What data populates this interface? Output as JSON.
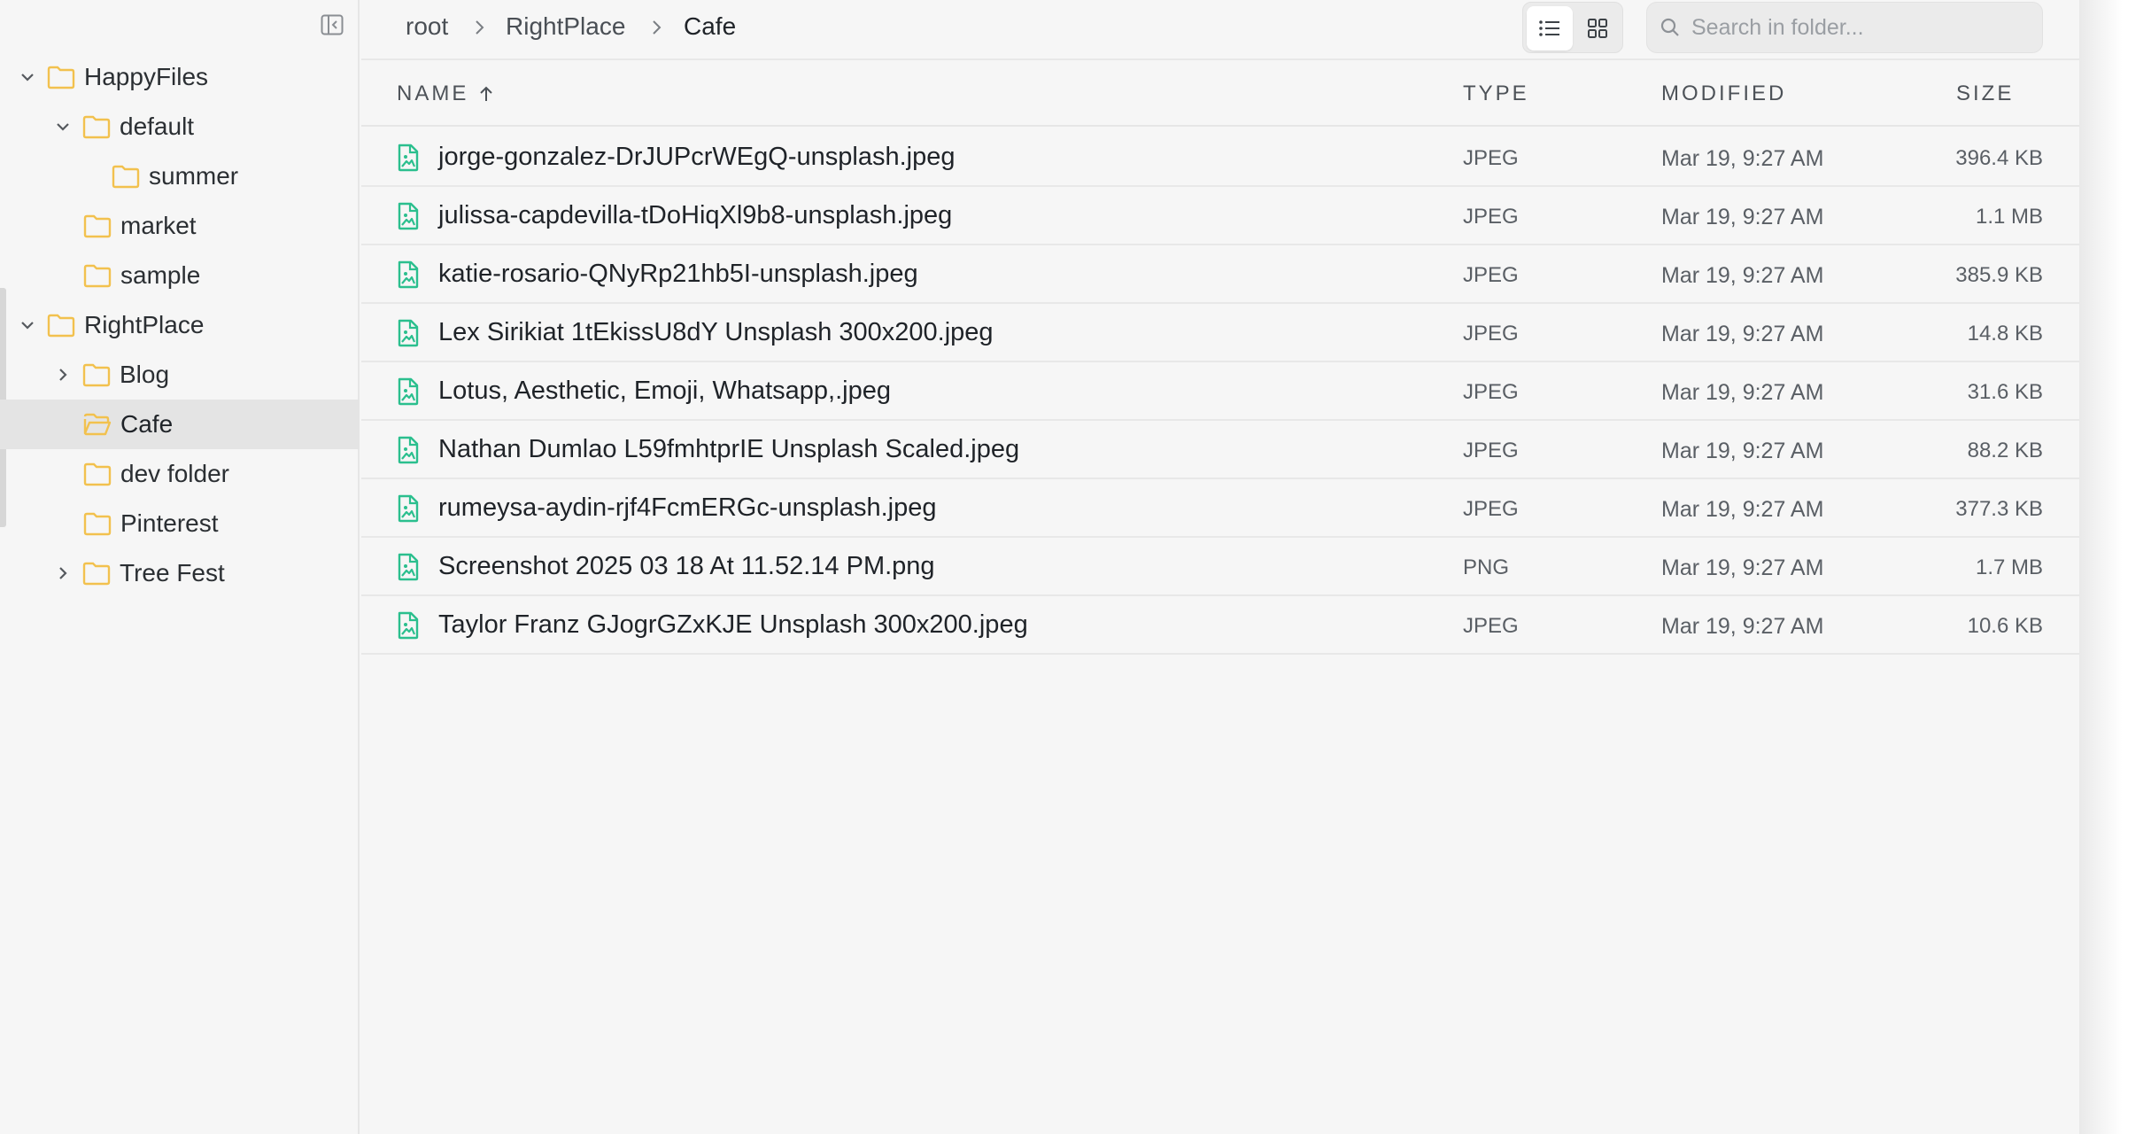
{
  "colors": {
    "folder": "#f2c14e",
    "file_icon": "#2bbf8e",
    "selected_row": "#e4e4e4",
    "background": "#f6f6f6"
  },
  "sidebar": {
    "tree": [
      {
        "label": "HappyFiles",
        "expanded": true,
        "has_caret": true
      },
      {
        "label": "default",
        "expanded": true,
        "has_caret": true
      },
      {
        "label": "summer",
        "has_caret": false
      },
      {
        "label": "market",
        "has_caret": false
      },
      {
        "label": "sample",
        "has_caret": false
      },
      {
        "label": "RightPlace",
        "expanded": true,
        "has_caret": true
      },
      {
        "label": "Blog",
        "expanded": false,
        "has_caret": true
      },
      {
        "label": "Cafe",
        "has_caret": false,
        "selected": true
      },
      {
        "label": "dev folder",
        "has_caret": false
      },
      {
        "label": "Pinterest",
        "has_caret": false
      },
      {
        "label": "Tree Fest",
        "expanded": false,
        "has_caret": true
      }
    ]
  },
  "breadcrumb": [
    "root",
    "RightPlace",
    "Cafe"
  ],
  "view_toggle": {
    "active": "list",
    "icons": [
      "list-icon",
      "grid-icon"
    ]
  },
  "search": {
    "placeholder": "Search in folder..."
  },
  "table": {
    "columns": {
      "name": "NAME",
      "type": "TYPE",
      "modified": "MODIFIED",
      "size": "SIZE"
    },
    "sort": {
      "column": "name",
      "direction": "ascending"
    },
    "rows": [
      {
        "name": "jorge-gonzalez-DrJUPcrWEgQ-unsplash.jpeg",
        "type": "JPEG",
        "modified": "Mar 19, 9:27 AM",
        "size": "396.4 KB"
      },
      {
        "name": "julissa-capdevilla-tDoHiqXl9b8-unsplash.jpeg",
        "type": "JPEG",
        "modified": "Mar 19, 9:27 AM",
        "size": "1.1 MB"
      },
      {
        "name": "katie-rosario-QNyRp21hb5I-unsplash.jpeg",
        "type": "JPEG",
        "modified": "Mar 19, 9:27 AM",
        "size": "385.9 KB"
      },
      {
        "name": "Lex Sirikiat 1tEkissU8dY Unsplash 300x200.jpeg",
        "type": "JPEG",
        "modified": "Mar 19, 9:27 AM",
        "size": "14.8 KB"
      },
      {
        "name": "Lotus, Aesthetic, Emoji, Whatsapp,.jpeg",
        "type": "JPEG",
        "modified": "Mar 19, 9:27 AM",
        "size": "31.6 KB"
      },
      {
        "name": "Nathan Dumlao L59fmhtprIE Unsplash Scaled.jpeg",
        "type": "JPEG",
        "modified": "Mar 19, 9:27 AM",
        "size": "88.2 KB"
      },
      {
        "name": "rumeysa-aydin-rjf4FcmERGc-unsplash.jpeg",
        "type": "JPEG",
        "modified": "Mar 19, 9:27 AM",
        "size": "377.3 KB"
      },
      {
        "name": "Screenshot 2025 03 18 At 11.52.14 PM.png",
        "type": "PNG",
        "modified": "Mar 19, 9:27 AM",
        "size": "1.7 MB"
      },
      {
        "name": "Taylor Franz GJogrGZxKJE Unsplash 300x200.jpeg",
        "type": "JPEG",
        "modified": "Mar 19, 9:27 AM",
        "size": "10.6 KB"
      }
    ]
  }
}
